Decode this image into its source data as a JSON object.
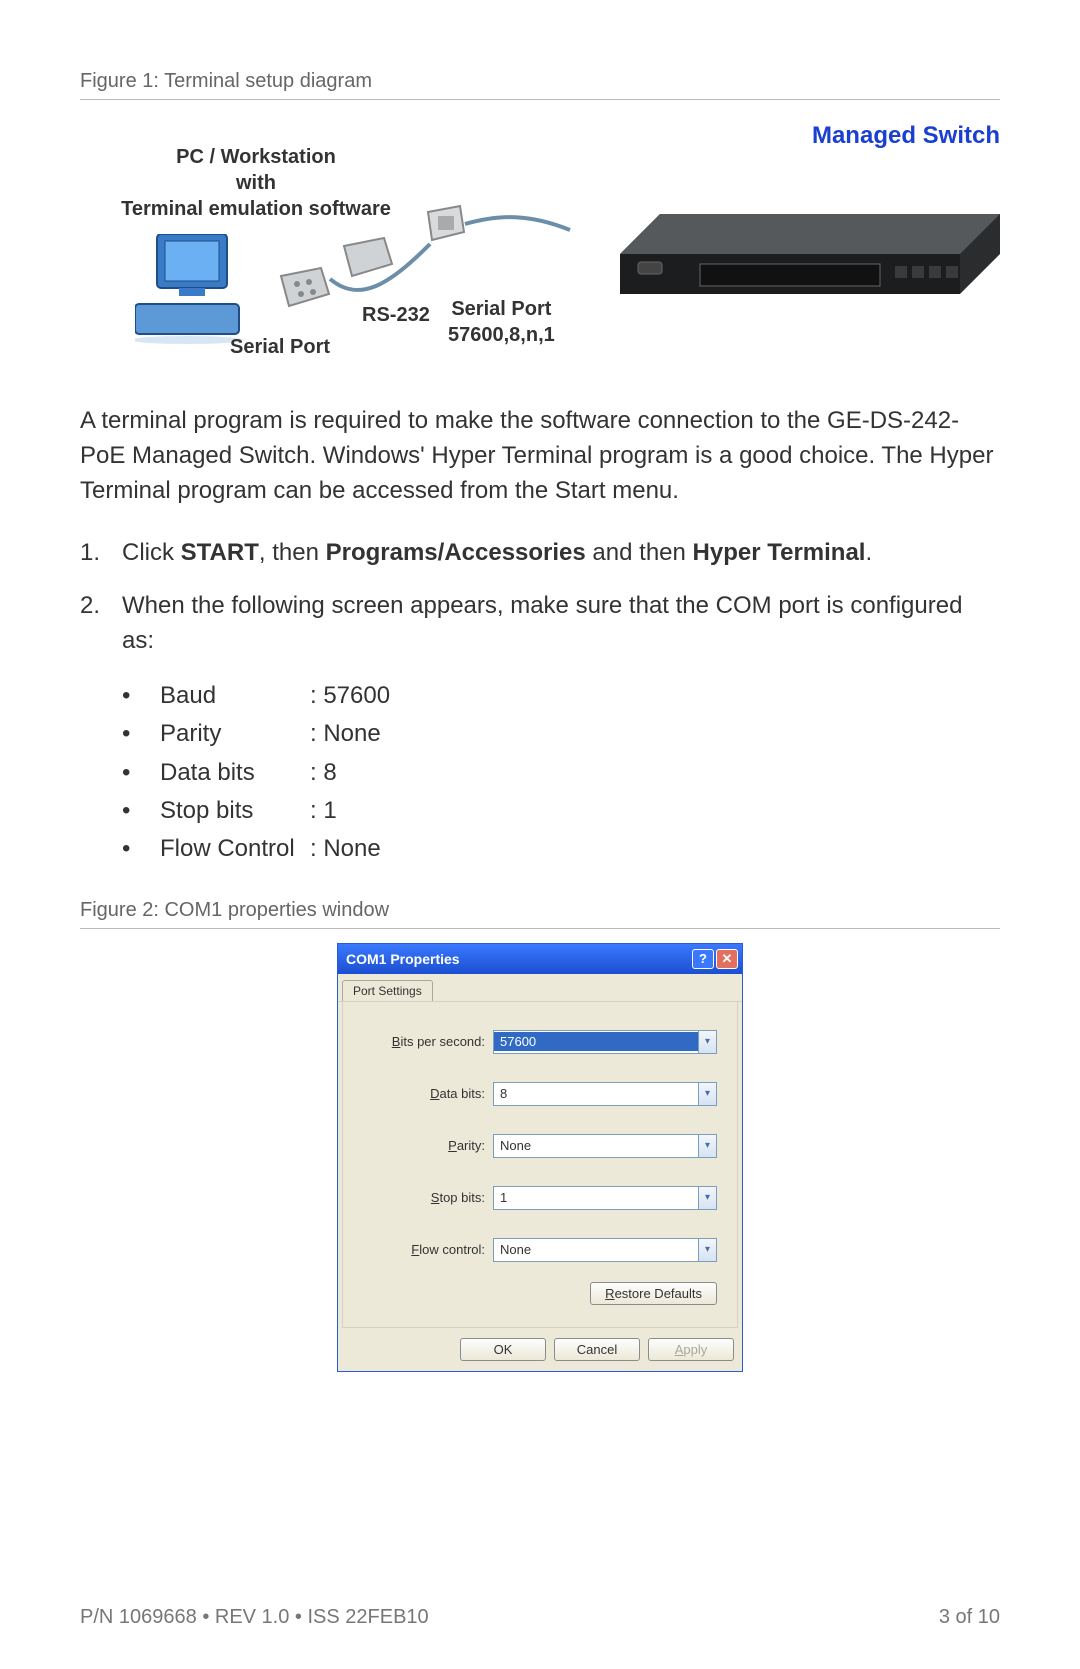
{
  "figure1": {
    "caption": "Figure 1: Terminal setup diagram",
    "pc_label_line1": "PC / Workstation",
    "pc_label_line2": "with",
    "pc_label_line3": "Terminal emulation software",
    "managed_switch": "Managed Switch",
    "rs232": "RS-232",
    "serial_port": "Serial Port",
    "serial_port_line2": "57600,8,n,1"
  },
  "intro_para": "A terminal program is required to make the software connection to the GE-DS-242-PoE Managed Switch. Windows' Hyper Terminal program is a good choice. The Hyper Terminal program can be accessed from the Start menu.",
  "steps": {
    "s1_pre": "Click ",
    "s1_b1": "START",
    "s1_mid1": ", then ",
    "s1_b2": "Programs/Accessories",
    "s1_mid2": " and then ",
    "s1_b3": "Hyper Terminal",
    "s1_post": ".",
    "s2": "When the following screen appears, make sure that the COM port is configured as:"
  },
  "com_settings": [
    {
      "label": "Baud",
      "value": ": 57600"
    },
    {
      "label": "Parity",
      "value": ": None"
    },
    {
      "label": "Data bits",
      "value": ": 8"
    },
    {
      "label": "Stop bits",
      "value": ": 1"
    },
    {
      "label": "Flow Control",
      "value": ": None"
    }
  ],
  "figure2": {
    "caption": "Figure 2: COM1 properties window",
    "title": "COM1 Properties",
    "tab": "Port Settings",
    "rows": [
      {
        "label_pre": "B",
        "label_rest": "its per second:",
        "value": "57600",
        "selected": true
      },
      {
        "label_pre": "D",
        "label_rest": "ata bits:",
        "value": "8",
        "selected": false
      },
      {
        "label_pre": "P",
        "label_rest": "arity:",
        "value": "None",
        "selected": false
      },
      {
        "label_pre": "S",
        "label_rest": "top bits:",
        "value": "1",
        "selected": false
      },
      {
        "label_pre": "F",
        "label_rest": "low control:",
        "value": "None",
        "selected": false
      }
    ],
    "restore_pre": "R",
    "restore_rest": "estore Defaults",
    "ok": "OK",
    "cancel": "Cancel",
    "apply_pre": "A",
    "apply_rest": "pply"
  },
  "footer": {
    "left": "P/N 1069668 • REV 1.0 • ISS 22FEB10",
    "right": "3 of 10"
  }
}
